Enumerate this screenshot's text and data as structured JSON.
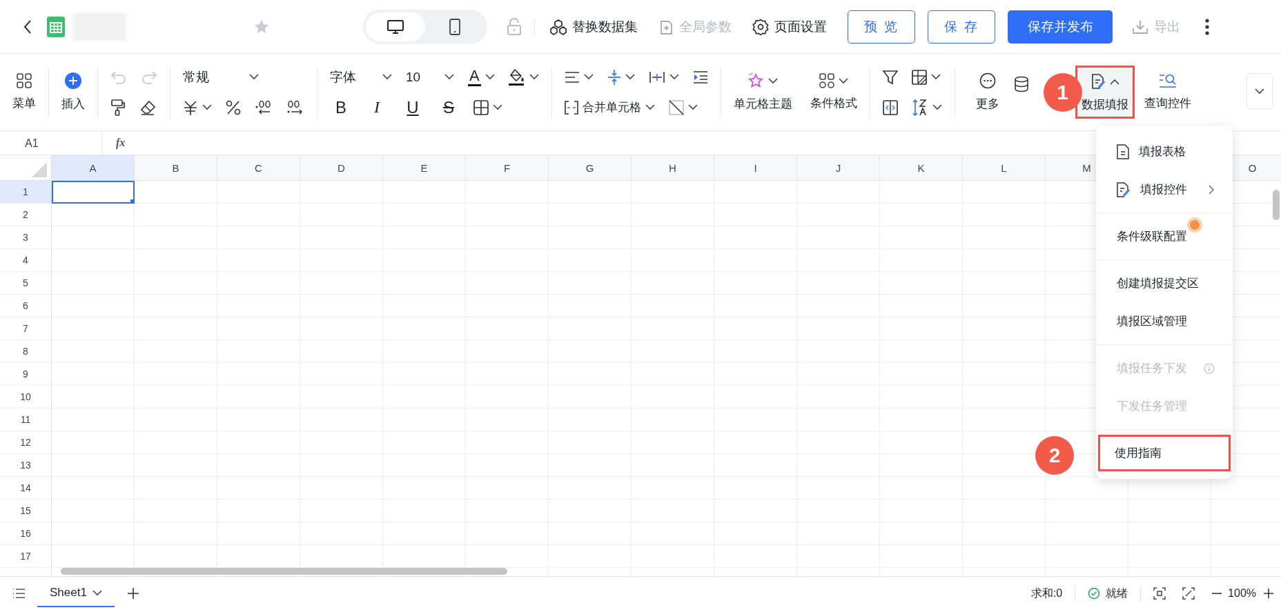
{
  "top_bar": {
    "view_toggle": [
      {
        "kind": "desktop",
        "selected": true
      },
      {
        "kind": "mobile",
        "selected": false
      }
    ],
    "actions": [
      {
        "kind": "replace",
        "label": "替换数据集",
        "disabled": false
      },
      {
        "kind": "params",
        "label": "全局参数",
        "disabled": true
      },
      {
        "kind": "settings",
        "label": "页面设置",
        "disabled": false
      }
    ],
    "buttons": [
      {
        "kind": "outline",
        "label": "预 览"
      },
      {
        "kind": "outline",
        "label": "保 存"
      },
      {
        "kind": "primary",
        "label": "保存并发布"
      }
    ],
    "export": {
      "label": "导出",
      "disabled": true
    }
  },
  "toolbar": {
    "menu": "菜单",
    "insert": "插入",
    "history": [
      {
        "kind": "undo",
        "disabled": true
      },
      {
        "kind": "redo",
        "disabled": true
      }
    ],
    "number_format": "常规",
    "font_family": "字体",
    "font_size": "10",
    "font_color": "A",
    "text_styles": [
      {
        "kind": "bold",
        "label": "B"
      },
      {
        "kind": "italic",
        "label": "I"
      },
      {
        "kind": "underline",
        "label": "U"
      },
      {
        "kind": "strike",
        "label": "S"
      }
    ],
    "merge": "合并单元格",
    "cell_theme": "单元格主题",
    "conditional_format": "条件格式",
    "more": "更多",
    "data_entry": {
      "label": "数据填报",
      "expanded": true,
      "highlighted": true,
      "callout": "1"
    },
    "query_control": "查询控件"
  },
  "formula_bar": {
    "cell_ref": "A1",
    "fx": "fx"
  },
  "sheet": {
    "columns": [
      {
        "label": "A",
        "selected": true
      },
      {
        "label": "B",
        "selected": false
      },
      {
        "label": "C",
        "selected": false
      },
      {
        "label": "D",
        "selected": false
      },
      {
        "label": "E",
        "selected": false
      },
      {
        "label": "F",
        "selected": false
      },
      {
        "label": "G",
        "selected": false
      },
      {
        "label": "H",
        "selected": false
      },
      {
        "label": "I",
        "selected": false
      },
      {
        "label": "J",
        "selected": false
      },
      {
        "label": "K",
        "selected": false
      },
      {
        "label": "L",
        "selected": false
      },
      {
        "label": "M",
        "selected": false
      },
      {},
      {
        "label": "O",
        "selected": false
      }
    ],
    "rows": [
      {
        "label": "1",
        "selected": true
      },
      {
        "label": "2",
        "selected": false
      },
      {
        "label": "3",
        "selected": false
      },
      {
        "label": "4",
        "selected": false
      },
      {
        "label": "5",
        "selected": false
      },
      {
        "label": "6",
        "selected": false
      },
      {
        "label": "7",
        "selected": false
      },
      {
        "label": "8",
        "selected": false
      },
      {
        "label": "9",
        "selected": false
      },
      {
        "label": "10",
        "selected": false
      },
      {
        "label": "11",
        "selected": false
      },
      {
        "label": "12",
        "selected": false
      },
      {
        "label": "13",
        "selected": false
      },
      {
        "label": "14",
        "selected": false
      },
      {
        "label": "15",
        "selected": false
      },
      {
        "label": "16",
        "selected": false
      },
      {
        "label": "17",
        "selected": false
      }
    ]
  },
  "dropdown_menu": {
    "groups": [
      [
        {
          "label": "填报表格",
          "kind": "doc",
          "disabled": false
        },
        {
          "label": "填报控件",
          "kind": "doc-edit",
          "disabled": false,
          "submenu": true
        }
      ],
      [
        {
          "label": "条件级联配置",
          "disabled": false,
          "hint_dot": true
        }
      ],
      [
        {
          "label": "创建填报提交区",
          "disabled": false
        },
        {
          "label": "填报区域管理",
          "disabled": false
        }
      ],
      [
        {
          "label": "填报任务下发",
          "disabled": true,
          "info": true
        },
        {
          "label": "下发任务管理",
          "disabled": true
        }
      ],
      [
        {
          "label": "使用指南",
          "disabled": false,
          "highlighted": true,
          "callout": "2"
        }
      ]
    ]
  },
  "status_bar": {
    "sheet_tabs": [
      {
        "label": "Sheet1",
        "selected": true
      }
    ],
    "sum": "求和:0",
    "status": "就绪",
    "zoom": "100%"
  }
}
